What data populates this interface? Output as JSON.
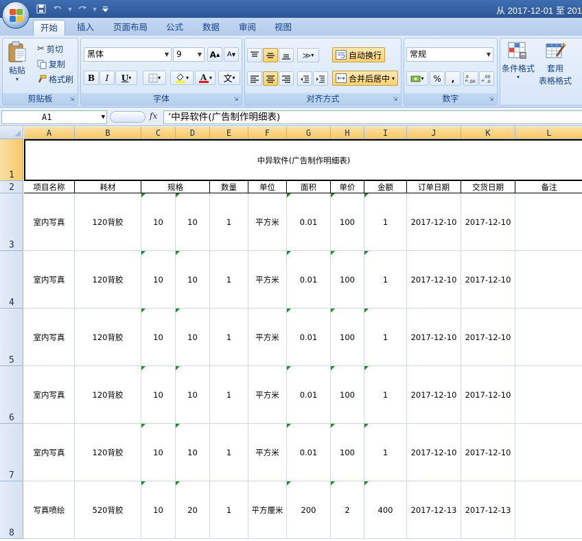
{
  "window": {
    "title": "从 2017-12-01 至 201"
  },
  "quick_access": {
    "save": "💾",
    "undo": "↶",
    "redo": "↷",
    "customize": "▾"
  },
  "tabs": [
    {
      "label": "开始",
      "active": true
    },
    {
      "label": "插入"
    },
    {
      "label": "页面布局"
    },
    {
      "label": "公式"
    },
    {
      "label": "数据"
    },
    {
      "label": "审阅"
    },
    {
      "label": "视图"
    }
  ],
  "ribbon": {
    "clipboard": {
      "label": "剪贴板",
      "paste": "粘贴",
      "cut": "剪切",
      "copy": "复制",
      "format_painter": "格式刷"
    },
    "font": {
      "label": "字体",
      "font_name": "黑体",
      "font_size": "9",
      "grow": "A",
      "shrink": "A",
      "bold": "B",
      "italic": "I",
      "underline": "U",
      "phonetic": "文"
    },
    "alignment": {
      "label": "对齐方式",
      "wrap_text": "自动换行",
      "merge_center": "合并后居中"
    },
    "number": {
      "label": "数字",
      "format": "常规",
      "percent": "%",
      "comma": ","
    },
    "styles": {
      "conditional": "条件格式",
      "table_format_1": "套用",
      "table_format_2": "表格格式"
    }
  },
  "formula_bar": {
    "name_box": "A1",
    "fx": "fx",
    "content": "’中异软件(广告制作明细表)"
  },
  "columns": [
    "A",
    "B",
    "C",
    "D",
    "E",
    "F",
    "G",
    "H",
    "I",
    "J",
    "K",
    "L"
  ],
  "rows": [
    "1",
    "2",
    "3",
    "4",
    "5",
    "6",
    "7",
    "8"
  ],
  "sheet": {
    "title": "中异软件(广告制作明细表)",
    "headers": [
      "项目名称",
      "耗材",
      "规格",
      "数量",
      "单位",
      "面积",
      "单价",
      "金额",
      "订单日期",
      "交货日期",
      "备注"
    ],
    "data": [
      [
        "室内写真",
        "120背胶",
        "10",
        "10",
        "1",
        "平方米",
        "0.01",
        "100",
        "1",
        "2017-12-10",
        "2017-12-10",
        ""
      ],
      [
        "室内写真",
        "120背胶",
        "10",
        "10",
        "1",
        "平方米",
        "0.01",
        "100",
        "1",
        "2017-12-10",
        "2017-12-10",
        ""
      ],
      [
        "室内写真",
        "120背胶",
        "10",
        "10",
        "1",
        "平方米",
        "0.01",
        "100",
        "1",
        "2017-12-10",
        "2017-12-10",
        ""
      ],
      [
        "室内写真",
        "120背胶",
        "10",
        "10",
        "1",
        "平方米",
        "0.01",
        "100",
        "1",
        "2017-12-10",
        "2017-12-10",
        ""
      ],
      [
        "室内写真",
        "120背胶",
        "10",
        "10",
        "1",
        "平方米",
        "0.01",
        "100",
        "1",
        "2017-12-10",
        "2017-12-10",
        ""
      ],
      [
        "写真喷绘",
        "520背胶",
        "10",
        "20",
        "1",
        "平方厘米",
        "200",
        "2",
        "400",
        "2017-12-13",
        "2017-12-13",
        ""
      ]
    ]
  },
  "colors": {
    "ribbon_text": "#15428b",
    "selected_header": "#f8c965",
    "text_number_indicator": "#1d8a2e"
  }
}
